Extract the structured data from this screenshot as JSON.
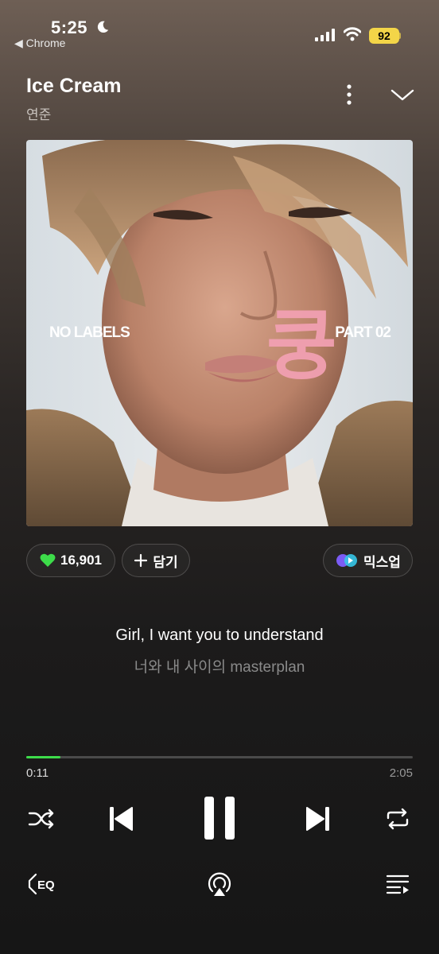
{
  "status_bar": {
    "time": "5:25",
    "back_app": "◀ Chrome",
    "battery": "92"
  },
  "header": {
    "title": "Ice Cream",
    "artist": "연준"
  },
  "album": {
    "left_text": "NO LABELS",
    "right_text": "PART 02",
    "sticker_text": "쿵"
  },
  "actions": {
    "like_count": "16,901",
    "add_label": "담기",
    "mix_label": "믹스업"
  },
  "lyrics": {
    "current": "Girl, I want you to understand",
    "next": "너와 내 사이의 masterplan"
  },
  "player": {
    "elapsed": "0:11",
    "total": "2:05",
    "progress_fraction": 0.088,
    "accent_color": "#3ddc4a"
  },
  "icons": {
    "shuffle": "shuffle-icon",
    "previous": "skip-previous-icon",
    "pause": "pause-icon",
    "next": "skip-next-icon",
    "repeat": "repeat-icon",
    "eq": "eq-icon",
    "eq_label": "EQ",
    "airplay": "airplay-icon",
    "queue": "queue-icon"
  }
}
